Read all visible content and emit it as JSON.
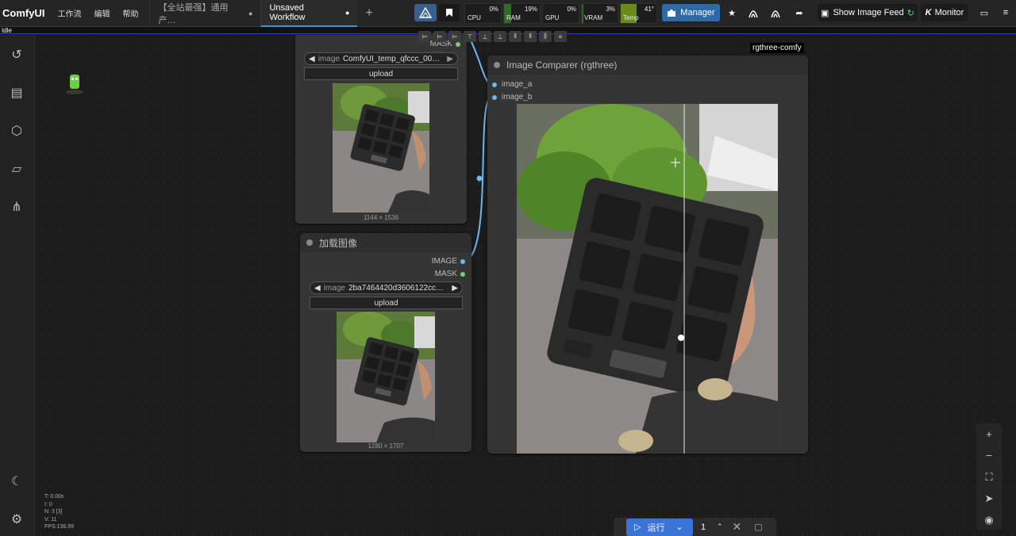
{
  "app": {
    "brand": "ComfyUI",
    "menu": [
      "工作流",
      "编辑",
      "帮助"
    ],
    "tabs": [
      {
        "label": "【全站最强】通用产…",
        "dot": "●"
      },
      {
        "label": "Unsaved Workflow",
        "dot": "●"
      }
    ],
    "add_tab": "+",
    "status": "Idle"
  },
  "monitors": [
    {
      "label": "CPU",
      "value": "0%"
    },
    {
      "label": "RAM",
      "value": "19%"
    },
    {
      "label": "GPU",
      "value": "0%"
    },
    {
      "label": "VRAM",
      "value": "3%"
    },
    {
      "label": "Temp",
      "value": "41°"
    }
  ],
  "topright": {
    "manager": "Manager",
    "image_feed": "Show Image Feed",
    "monitor": "Monitor"
  },
  "tag": "rgthree-comfy",
  "nodes": {
    "load1": {
      "out_mask": "MASK",
      "image_key": "image",
      "image_value": "ComfyUI_temp_qfccc_00…",
      "upload": "upload",
      "size": "1144 × 1536"
    },
    "load2": {
      "title": "加载图像",
      "out_image": "IMAGE",
      "out_mask": "MASK",
      "image_key": "image",
      "image_value": "2ba7464420d3606122cc…",
      "upload": "upload",
      "size": "1280 × 1707"
    },
    "comparer": {
      "title": "Image Comparer (rgthree)",
      "in_a": "image_a",
      "in_b": "image_b"
    }
  },
  "run": {
    "label": "运行",
    "count": "1"
  },
  "stats": [
    "T: 0.00s",
    "I: 0",
    "N: 3 [3]",
    "V: 11",
    "FPS:136.99"
  ],
  "colors": {
    "accent": "#3a74d6",
    "slot_image": "#6cb7f1",
    "slot_mask": "#81c784",
    "link": "#6cb7f1"
  }
}
